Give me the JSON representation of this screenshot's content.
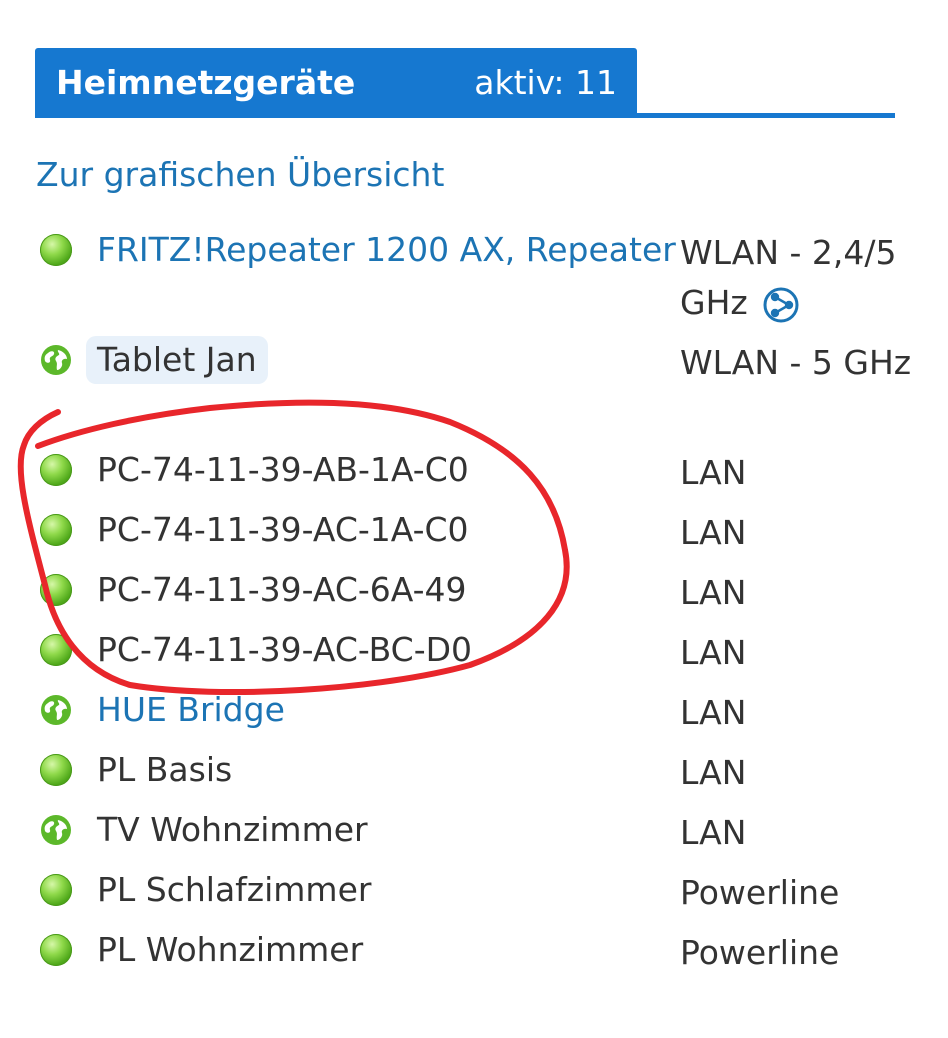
{
  "header": {
    "title": "Heimnetzgeräte",
    "active_count": "aktiv: 11"
  },
  "overview_link": "Zur grafischen Übersicht",
  "devices": [
    {
      "name": "FRITZ!Repeater 1200 AX, Repeater",
      "connection": "WLAN - 2,4/5 GHz",
      "status_icon": "online-dot-icon",
      "mesh_icon": "mesh-icon"
    },
    {
      "name": "Tablet Jan",
      "connection": "WLAN - 5 GHz",
      "status_icon": "internet-globe-icon"
    },
    {
      "name": "PC-74-11-39-AB-1A-C0",
      "connection": "LAN",
      "status_icon": "online-dot-icon"
    },
    {
      "name": "PC-74-11-39-AC-1A-C0",
      "connection": "LAN",
      "status_icon": "online-dot-icon"
    },
    {
      "name": "PC-74-11-39-AC-6A-49",
      "connection": "LAN",
      "status_icon": "online-dot-icon"
    },
    {
      "name": "PC-74-11-39-AC-BC-D0",
      "connection": "LAN",
      "status_icon": "online-dot-icon"
    },
    {
      "name": "HUE Bridge",
      "connection": "LAN",
      "status_icon": "internet-globe-icon"
    },
    {
      "name": "PL Basis",
      "connection": "LAN",
      "status_icon": "online-dot-icon"
    },
    {
      "name": "TV Wohnzimmer",
      "connection": "LAN",
      "status_icon": "internet-globe-icon"
    },
    {
      "name": "PL Schlafzimmer",
      "connection": "Powerline",
      "status_icon": "online-dot-icon"
    },
    {
      "name": "PL Wohnzimmer",
      "connection": "Powerline",
      "status_icon": "online-dot-icon"
    }
  ],
  "colors": {
    "accent": "#1678d0",
    "link": "#1c74b4",
    "online": "#5cb82a",
    "annotation": "#e8262b"
  }
}
